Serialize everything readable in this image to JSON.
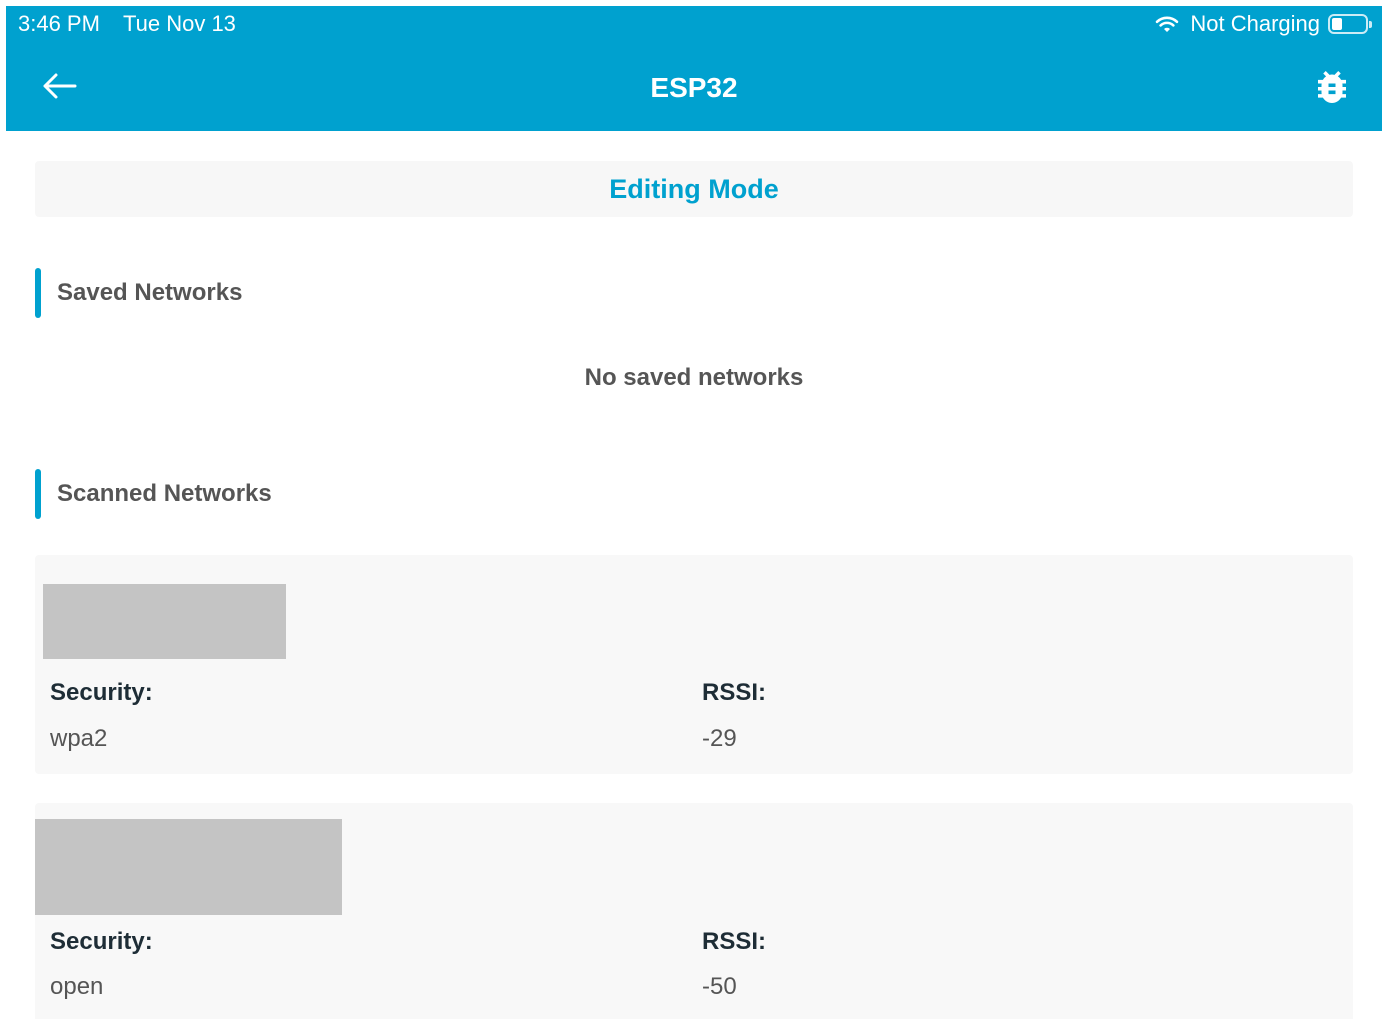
{
  "status_bar": {
    "time": "3:46 PM",
    "date": "Tue Nov 13",
    "charging": "Not Charging",
    "battery_level": 0.3
  },
  "header": {
    "title": "ESP32"
  },
  "editing_mode": {
    "label": "Editing Mode"
  },
  "saved_networks": {
    "heading": "Saved Networks",
    "empty_message": "No saved networks",
    "items": []
  },
  "scanned_networks": {
    "heading": "Scanned Networks",
    "items": [
      {
        "security_label": "Security:",
        "security": "wpa2",
        "rssi_label": "RSSI:",
        "rssi": "-29"
      },
      {
        "security_label": "Security:",
        "security": "open",
        "rssi_label": "RSSI:",
        "rssi": "-50"
      }
    ]
  },
  "icons": {
    "back": "back-arrow-icon",
    "debug": "bug-icon",
    "wifi": "wifi-icon",
    "battery": "battery-icon"
  },
  "colors": {
    "accent": "#00a1cf",
    "panel_background": "#f8f8f8",
    "muted_text": "#555555",
    "label_text": "#1e2d36",
    "redacted": "#c4c4c4"
  }
}
